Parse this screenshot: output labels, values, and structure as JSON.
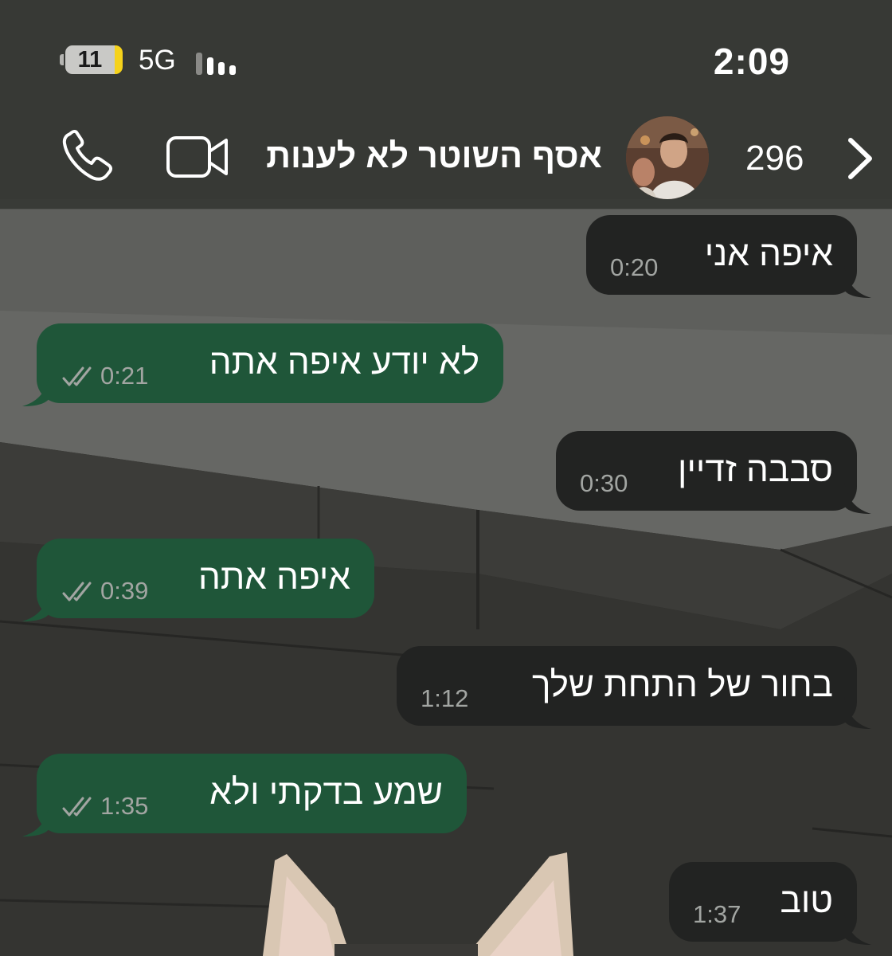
{
  "status_bar": {
    "time": "2:09",
    "battery": "11",
    "network": "5G"
  },
  "header": {
    "contact_name": "אסף השוטר לא לענות",
    "unread_count": "296",
    "icons": [
      "back-chevron-icon",
      "avatar",
      "video-call-icon",
      "voice-call-icon"
    ]
  },
  "messages": [
    {
      "direction": "incoming",
      "text": "איפה אני",
      "time": "0:20"
    },
    {
      "direction": "outgoing",
      "text": "לא יודע איפה אתה",
      "time": "0:21",
      "status": "read"
    },
    {
      "direction": "incoming",
      "text": "סבבה זדיין",
      "time": "0:30"
    },
    {
      "direction": "outgoing",
      "text": "איפה אתה",
      "time": "0:39",
      "status": "read"
    },
    {
      "direction": "incoming",
      "text": "בחור של התחת שלך",
      "time": "1:12"
    },
    {
      "direction": "outgoing",
      "text": "שמע בדקתי ולא",
      "time": "1:35",
      "status": "read"
    },
    {
      "direction": "incoming",
      "text": "טוב",
      "time": "1:37"
    }
  ],
  "colors": {
    "header_bg": "#383a36",
    "incoming_bubble": "#222322",
    "outgoing_bubble": "#1f5639",
    "time_text": "#a2a5a2",
    "battery_accent": "#f5d21b"
  }
}
